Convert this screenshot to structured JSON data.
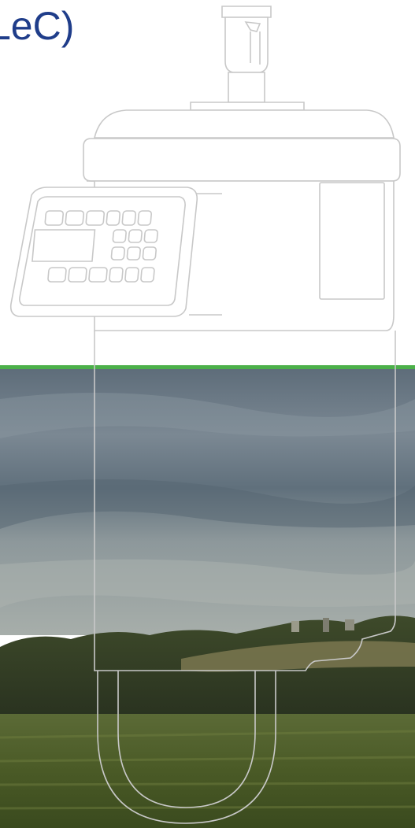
{
  "heading": {
    "text": "LeC)"
  },
  "colors": {
    "heading": "#1f3d8a",
    "accent_rule": "#4cb04a",
    "outline": "#c8c8c8",
    "sky_top": "#6b7a86",
    "sky_bottom": "#9aa5a8",
    "field": "#4f5f2c"
  },
  "icons": {
    "device": "sampler-device-outline"
  }
}
